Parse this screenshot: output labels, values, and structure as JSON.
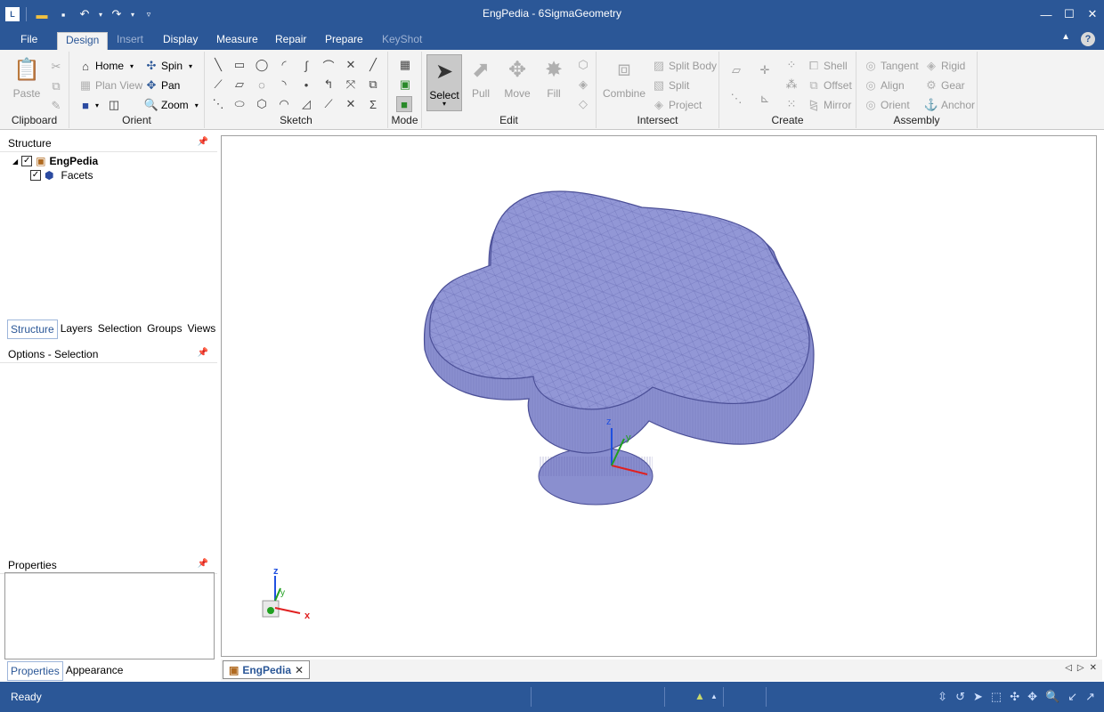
{
  "window": {
    "title": "EngPedia - 6SigmaGeometry"
  },
  "tabs": [
    {
      "label": "File"
    },
    {
      "label": "Design"
    },
    {
      "label": "Insert"
    },
    {
      "label": "Display"
    },
    {
      "label": "Measure"
    },
    {
      "label": "Repair"
    },
    {
      "label": "Prepare"
    },
    {
      "label": "KeyShot"
    }
  ],
  "ribbon": {
    "clipboard": {
      "label": "Clipboard",
      "paste": "Paste"
    },
    "orient": {
      "label": "Orient",
      "home": "Home",
      "plan_view": "Plan View",
      "spin": "Spin",
      "pan": "Pan",
      "zoom": "Zoom"
    },
    "sketch": {
      "label": "Sketch"
    },
    "mode": {
      "label": "Mode"
    },
    "edit": {
      "label": "Edit",
      "select": "Select",
      "pull": "Pull",
      "move": "Move",
      "fill": "Fill"
    },
    "intersect": {
      "label": "Intersect",
      "combine": "Combine",
      "split_body": "Split Body",
      "split": "Split",
      "project": "Project"
    },
    "create": {
      "label": "Create",
      "shell": "Shell",
      "offset": "Offset",
      "mirror": "Mirror"
    },
    "assembly": {
      "label": "Assembly",
      "tangent": "Tangent",
      "align": "Align",
      "orient": "Orient",
      "rigid": "Rigid",
      "gear": "Gear",
      "anchor": "Anchor"
    }
  },
  "structure": {
    "title": "Structure",
    "root": "EngPedia",
    "child": "Facets"
  },
  "panel_tabs": [
    "Structure",
    "Layers",
    "Selection",
    "Groups",
    "Views"
  ],
  "options": {
    "title": "Options - Selection"
  },
  "properties": {
    "title": "Properties",
    "tabs": [
      "Properties",
      "Appearance"
    ]
  },
  "document_tab": {
    "label": "EngPedia"
  },
  "axes": {
    "x": "x",
    "y": "y",
    "z": "z"
  },
  "status": {
    "text": "Ready"
  },
  "colors": {
    "accent": "#2b5797",
    "model_fill": "#8a8fcf",
    "model_mesh": "#5a5fa8"
  }
}
